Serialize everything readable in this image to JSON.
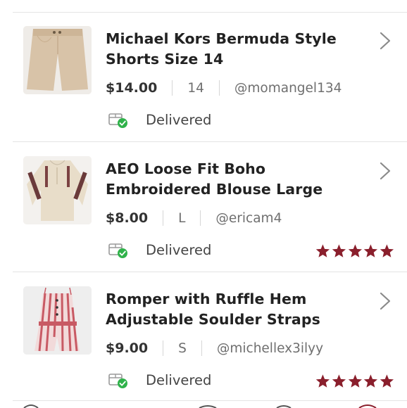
{
  "orders": [
    {
      "title_line1": "Michael Kors Bermuda Style",
      "title_line2": "Shorts Size 14",
      "price": "$14.00",
      "size": "14",
      "seller": "@momangel134",
      "status": "Delivered",
      "thumbnail": "beige-shorts-image",
      "rating_stars": 0
    },
    {
      "title_line1": "AEO Loose Fit Boho",
      "title_line2": "Embroidered Blouse Large",
      "price": "$8.00",
      "size": "L",
      "seller": "@ericam4",
      "status": "Delivered",
      "thumbnail": "boho-blouse-image",
      "rating_stars": 5
    },
    {
      "title_line1": "Romper with Ruffle Hem",
      "title_line2": "Adjustable Soulder Straps",
      "price": "$9.00",
      "size": "S",
      "seller": "@michellex3ilyy",
      "status": "Delivered",
      "thumbnail": "striped-romper-image",
      "rating_stars": 5
    }
  ],
  "colors": {
    "star": "#8a1f2c",
    "check": "#2fb24a",
    "chevron": "#8a8a8a",
    "divider": "#e4e4e4"
  },
  "icons": [
    "chevron-right-icon",
    "package-delivered-icon",
    "star-icon"
  ]
}
